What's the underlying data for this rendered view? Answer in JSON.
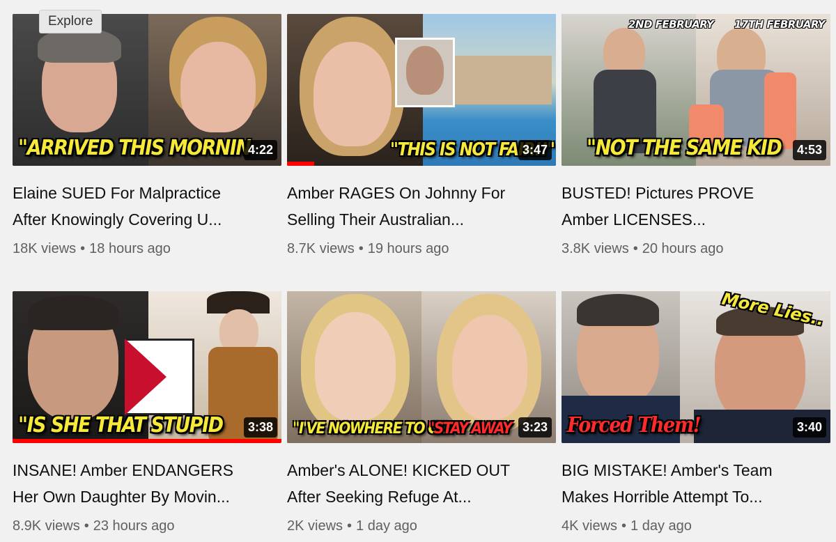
{
  "tooltip": {
    "explore_label": "Explore"
  },
  "videos": [
    {
      "caption": "\"ARRIVED THIS MORNIN",
      "duration": "4:22",
      "title_line1": "Elaine SUED For Malpractice",
      "title_line2": "After Knowingly Covering U...",
      "views": "18K views",
      "age": "18 hours ago",
      "progress_fraction": 0
    },
    {
      "caption": "\"THIS IS NOT FAIR!!\"",
      "duration": "3:47",
      "title_line1": "Amber RAGES On Johnny For",
      "title_line2": "Selling Their Australian...",
      "views": "8.7K views",
      "age": "19 hours ago",
      "progress_fraction": 0.1
    },
    {
      "caption": "\"NOT THE SAME KID",
      "duration": "4:53",
      "title_line1": "BUSTED! Pictures PROVE",
      "title_line2": "Amber LICENSES...",
      "views": "3.8K views",
      "age": "20 hours ago",
      "tag_left": "2ND FEBRUARY",
      "tag_right": "17TH FEBRUARY",
      "progress_fraction": 0
    },
    {
      "caption": "\"IS SHE THAT STUPID",
      "duration": "3:38",
      "title_line1": "INSANE! Amber ENDANGERS",
      "title_line2": "Her Own Daughter By Movin...",
      "views": "8.9K views",
      "age": "23 hours ago",
      "progress_fraction": 1
    },
    {
      "caption": "\"I'VE NOWHERE TO GO!\"",
      "caption2": "\"STAY AWAY",
      "duration": "3:23",
      "title_line1": "Amber's ALONE! KICKED OUT",
      "title_line2": "After Seeking Refuge At...",
      "views": "2K views",
      "age": "1 day ago",
      "progress_fraction": 0
    },
    {
      "caption": "Forced Them!",
      "tag_right": "More Lies..",
      "duration": "3:40",
      "title_line1": "BIG MISTAKE! Amber's Team",
      "title_line2": "Makes Horrible Attempt To...",
      "views": "4K views",
      "age": "1 day ago",
      "progress_fraction": 0
    }
  ],
  "colors": {
    "page_bg": "#f1f1f1",
    "caption_yellow": "#f7e93a",
    "progress_red": "#ff0000",
    "meta_gray": "#606060"
  }
}
